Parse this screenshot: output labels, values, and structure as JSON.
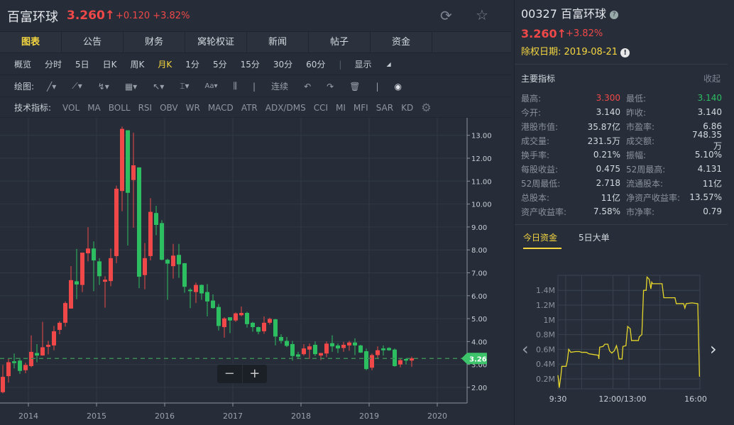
{
  "header": {
    "name": "百富环球",
    "price": "3.260",
    "arrow": "↑",
    "change": "+0.120 +3.82%"
  },
  "tabs": [
    "图表",
    "公告",
    "财务",
    "窝轮权证",
    "新闻",
    "帖子",
    "资金"
  ],
  "periods": [
    "概览",
    "分时",
    "5日",
    "日K",
    "周K",
    "月K",
    "1分",
    "5分",
    "15分",
    "30分",
    "60分"
  ],
  "active_period": "月K",
  "display_label": "显示",
  "draw": {
    "label": "绘图:",
    "continuous": "连续"
  },
  "indicators": {
    "label": "技术指标:",
    "items": [
      "VOL",
      "MA",
      "BOLL",
      "RSI",
      "OBV",
      "WR",
      "MACD",
      "ATR",
      "ADX/DMS",
      "CCI",
      "MI",
      "MFI",
      "SAR",
      "KD"
    ]
  },
  "colors": {
    "up": "#f04848",
    "down": "#2dbe62",
    "accent": "#f5d640"
  },
  "chart_data": {
    "type": "candlestick",
    "interval": "monthly",
    "first_month": "2013-09",
    "y_ticks": [
      "2.00",
      "3.00",
      "4.00",
      "5.00",
      "6.00",
      "7.00",
      "8.00",
      "9.00",
      "10.00",
      "11.00",
      "12.00",
      "13.00"
    ],
    "x_ticks": [
      "2014",
      "2015",
      "2016",
      "2017",
      "2018",
      "2019",
      "2020"
    ],
    "last_price": "3.26",
    "ohlc": [
      [
        1.79,
        2.98,
        1.74,
        2.46
      ],
      [
        2.49,
        3.24,
        2.21,
        3.1
      ],
      [
        3.14,
        3.48,
        2.83,
        3.06
      ],
      [
        3.17,
        3.29,
        2.59,
        2.72
      ],
      [
        2.75,
        3.08,
        2.62,
        2.98
      ],
      [
        2.93,
        4.27,
        2.88,
        3.55
      ],
      [
        3.5,
        3.89,
        3.1,
        3.39
      ],
      [
        3.39,
        4.86,
        3.39,
        3.75
      ],
      [
        3.77,
        4.03,
        3.44,
        3.86
      ],
      [
        3.83,
        4.68,
        3.62,
        4.45
      ],
      [
        4.51,
        4.89,
        4.32,
        4.82
      ],
      [
        4.82,
        5.75,
        4.65,
        5.68
      ],
      [
        5.44,
        7.29,
        5.44,
        6.68
      ],
      [
        6.63,
        8.04,
        5.85,
        6.49
      ],
      [
        6.47,
        7.88,
        6.16,
        7.88
      ],
      [
        7.85,
        8.99,
        7.5,
        8.06
      ],
      [
        8.06,
        8.37,
        6.2,
        7.54
      ],
      [
        7.5,
        7.64,
        6.47,
        6.85
      ],
      [
        6.61,
        6.85,
        5.48,
        6.7
      ],
      [
        6.64,
        8.06,
        6.41,
        7.64
      ],
      [
        7.73,
        10.8,
        7.42,
        10.67
      ],
      [
        10.57,
        13.38,
        9.69,
        13.28
      ],
      [
        13.22,
        13.22,
        8.19,
        10.49
      ],
      [
        11.05,
        13.11,
        8.97,
        11.69
      ],
      [
        11.6,
        11.6,
        6.33,
        6.83
      ],
      [
        6.9,
        8.3,
        6.28,
        7.64
      ],
      [
        7.73,
        10.26,
        7.54,
        9.66
      ],
      [
        9.61,
        9.92,
        8.64,
        9.09
      ],
      [
        9.17,
        9.3,
        7.54,
        7.57
      ],
      [
        7.57,
        7.62,
        5.82,
        7.4
      ],
      [
        7.29,
        8.26,
        6.75,
        7.75
      ],
      [
        7.78,
        8.26,
        6.78,
        7.37
      ],
      [
        7.42,
        7.42,
        6.13,
        6.39
      ],
      [
        6.26,
        6.33,
        5.46,
        6.2
      ],
      [
        6.16,
        6.57,
        5.68,
        6.47
      ],
      [
        6.47,
        6.49,
        5.82,
        6.1
      ],
      [
        6.16,
        6.51,
        5.1,
        5.75
      ],
      [
        5.79,
        6.06,
        5.44,
        5.46
      ],
      [
        5.51,
        5.64,
        4.48,
        4.68
      ],
      [
        4.63,
        5.06,
        4.17,
        5.01
      ],
      [
        5.06,
        5.06,
        4.37,
        4.92
      ],
      [
        4.92,
        5.27,
        4.86,
        5.23
      ],
      [
        5.15,
        5.53,
        5.1,
        5.25
      ],
      [
        5.25,
        5.3,
        4.61,
        4.76
      ],
      [
        4.82,
        4.86,
        4.43,
        4.63
      ],
      [
        4.63,
        4.65,
        4.32,
        4.43
      ],
      [
        4.45,
        5.1,
        4.34,
        4.82
      ],
      [
        4.82,
        5.04,
        4.74,
        4.99
      ],
      [
        4.97,
        4.99,
        3.83,
        4.22
      ],
      [
        4.2,
        4.32,
        3.91,
        4.03
      ],
      [
        4.03,
        4.2,
        3.76,
        3.81
      ],
      [
        3.89,
        4.03,
        3.17,
        3.37
      ],
      [
        3.44,
        3.55,
        3.27,
        3.34
      ],
      [
        3.45,
        3.89,
        3.39,
        3.7
      ],
      [
        3.65,
        3.91,
        3.24,
        3.79
      ],
      [
        3.86,
        4.01,
        3.37,
        3.45
      ],
      [
        3.39,
        3.5,
        3.19,
        3.5
      ],
      [
        3.48,
        4.01,
        3.32,
        3.91
      ],
      [
        3.93,
        4.27,
        3.55,
        3.79
      ],
      [
        3.83,
        3.91,
        3.5,
        3.7
      ],
      [
        3.72,
        3.99,
        3.55,
        3.86
      ],
      [
        3.83,
        4.03,
        3.6,
        3.96
      ],
      [
        3.96,
        4.14,
        3.41,
        3.83
      ],
      [
        3.83,
        3.86,
        3.5,
        3.52
      ],
      [
        3.58,
        3.7,
        2.75,
        2.8
      ],
      [
        2.86,
        3.48,
        2.75,
        3.41
      ],
      [
        3.41,
        3.79,
        3.27,
        3.62
      ],
      [
        3.7,
        3.83,
        3.39,
        3.62
      ],
      [
        3.72,
        3.75,
        3.6,
        3.62
      ],
      [
        3.65,
        3.7,
        2.9,
        2.93
      ],
      [
        3.0,
        3.27,
        2.88,
        3.19
      ],
      [
        3.24,
        3.27,
        3.0,
        3.17
      ],
      [
        3.17,
        3.34,
        2.9,
        3.27
      ]
    ]
  },
  "zoom": {
    "minus": "−",
    "plus": "+"
  },
  "panel": {
    "title": "00327 百富环球",
    "price": "3.260",
    "arrow": "↑",
    "pct": "+3.82%",
    "ex_date": "除权日期: 2019-08-21",
    "section": "主要指标",
    "collapse": "收起",
    "stats": [
      [
        "最高:",
        "3.300",
        "最低:",
        "3.140"
      ],
      [
        "今开:",
        "3.140",
        "昨收:",
        "3.140"
      ],
      [
        "港股市值:",
        "35.87亿",
        "市盈率:",
        "6.86"
      ],
      [
        "成交量:",
        "231.5万",
        "成交额:",
        "748.35万"
      ],
      [
        "换手率:",
        "0.21%",
        "振幅:",
        "5.10%"
      ],
      [
        "每股收益:",
        "0.475",
        "52周最高:",
        "4.131"
      ],
      [
        "52周最低:",
        "2.718",
        "流通股本:",
        "11亿"
      ],
      [
        "总股本:",
        "11亿",
        "净资产收益率:",
        "13.57%"
      ],
      [
        "资产收益率:",
        "7.58%",
        "市净率:",
        "0.79"
      ]
    ],
    "fund_tabs": [
      "今日资金",
      "5日大单"
    ]
  },
  "fund_chart": {
    "type": "line",
    "y_ticks": [
      "0.2M",
      "0.4M",
      "0.6M",
      "0.8M",
      "1M",
      "1.2M",
      "1.4M"
    ],
    "x_ticks": [
      "9:30",
      "12:00/13:00",
      "16:00"
    ],
    "minutes": [
      0,
      3,
      7,
      9,
      19,
      22,
      25,
      30,
      41,
      50,
      55,
      66,
      72,
      83,
      94,
      95,
      97,
      105,
      109,
      116,
      120,
      125,
      131,
      136,
      139,
      142,
      149,
      151,
      158,
      162,
      168,
      171,
      187,
      189,
      195,
      199,
      205,
      207,
      212,
      216,
      218,
      220,
      242,
      246,
      272,
      275,
      292,
      295,
      298,
      311,
      325,
      329
    ],
    "values": [
      0.25,
      0.08,
      0.25,
      0.37,
      0.37,
      0.45,
      0.6,
      0.56,
      0.57,
      0.57,
      0.56,
      0.56,
      0.54,
      0.53,
      0.52,
      0.47,
      0.63,
      0.64,
      0.67,
      0.67,
      0.58,
      0.55,
      0.58,
      0.65,
      0.58,
      0.47,
      0.47,
      0.64,
      0.65,
      0.91,
      0.88,
      0.72,
      0.72,
      0.77,
      0.8,
      1.4,
      1.4,
      1.58,
      1.55,
      1.42,
      1.51,
      1.49,
      1.49,
      1.3,
      1.3,
      1.22,
      1.22,
      1.16,
      1.22,
      1.23,
      1.22,
      0.23
    ]
  }
}
